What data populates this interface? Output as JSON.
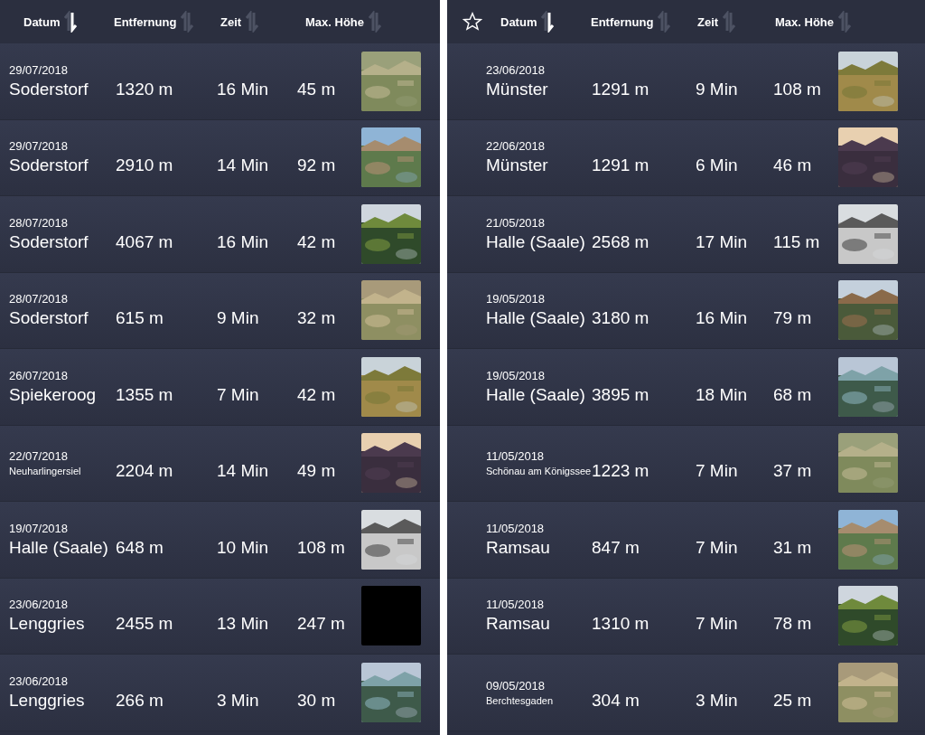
{
  "panels": [
    {
      "columns": [
        {
          "label": "Datum",
          "sorted": true
        },
        {
          "label": "Entfernung",
          "sorted": false
        },
        {
          "label": "Zeit",
          "sorted": false
        },
        {
          "label": "Max. Höhe",
          "sorted": false
        }
      ],
      "rows": [
        {
          "date": "29/07/2018",
          "place": "Soderstorf",
          "compact": false,
          "distance": "1320 m",
          "time": "16 Min",
          "height": "45 m"
        },
        {
          "date": "29/07/2018",
          "place": "Soderstorf",
          "compact": false,
          "distance": "2910 m",
          "time": "14 Min",
          "height": "92 m"
        },
        {
          "date": "28/07/2018",
          "place": "Soderstorf",
          "compact": false,
          "distance": "4067 m",
          "time": "16 Min",
          "height": "42 m"
        },
        {
          "date": "28/07/2018",
          "place": "Soderstorf",
          "compact": false,
          "distance": "615 m",
          "time": "9 Min",
          "height": "32 m"
        },
        {
          "date": "26/07/2018",
          "place": "Spiekeroog",
          "compact": false,
          "distance": "1355 m",
          "time": "7 Min",
          "height": "42 m"
        },
        {
          "date": "22/07/2018",
          "place": "Neuharlingersiel",
          "compact": true,
          "distance": "2204 m",
          "time": "14 Min",
          "height": "49 m"
        },
        {
          "date": "19/07/2018",
          "place": "Halle (Saale)",
          "compact": false,
          "distance": "648 m",
          "time": "10 Min",
          "height": "108 m"
        },
        {
          "date": "23/06/2018",
          "place": "Lenggries",
          "compact": false,
          "distance": "2455 m",
          "time": "13 Min",
          "height": "247 m",
          "thumbnail": {
            "kind": "blank"
          }
        },
        {
          "date": "23/06/2018",
          "place": "Lenggries",
          "compact": false,
          "distance": "266 m",
          "time": "3 Min",
          "height": "30 m"
        }
      ]
    },
    {
      "favorites_filter": {
        "on": false
      },
      "columns": [
        {
          "label": "Datum",
          "sorted": true
        },
        {
          "label": "Entfernung",
          "sorted": false
        },
        {
          "label": "Zeit",
          "sorted": false
        },
        {
          "label": "Max. Höhe",
          "sorted": false
        }
      ],
      "rows": [
        {
          "date": "23/06/2018",
          "place": "Münster",
          "compact": false,
          "distance": "1291 m",
          "time": "9 Min",
          "height": "108 m"
        },
        {
          "date": "22/06/2018",
          "place": "Münster",
          "compact": false,
          "distance": "1291 m",
          "time": "6 Min",
          "height": "46 m"
        },
        {
          "date": "21/05/2018",
          "place": "Halle (Saale)",
          "compact": false,
          "distance": "2568 m",
          "time": "17 Min",
          "height": "115 m"
        },
        {
          "date": "19/05/2018",
          "place": "Halle (Saale)",
          "compact": false,
          "distance": "3180 m",
          "time": "16 Min",
          "height": "79 m"
        },
        {
          "date": "19/05/2018",
          "place": "Halle (Saale)",
          "compact": false,
          "distance": "3895 m",
          "time": "18 Min",
          "height": "68 m"
        },
        {
          "date": "11/05/2018",
          "place": "Schönau am Königssee",
          "compact": true,
          "distance": "1223 m",
          "time": "7 Min",
          "height": "37 m"
        },
        {
          "date": "11/05/2018",
          "place": "Ramsau",
          "compact": false,
          "distance": "847 m",
          "time": "7 Min",
          "height": "31 m"
        },
        {
          "date": "11/05/2018",
          "place": "Ramsau",
          "compact": false,
          "distance": "1310 m",
          "time": "7 Min",
          "height": "78 m"
        },
        {
          "date": "09/05/2018",
          "place": "Berchtesgaden",
          "compact": true,
          "distance": "304 m",
          "time": "3 Min",
          "height": "25 m"
        }
      ]
    }
  ]
}
